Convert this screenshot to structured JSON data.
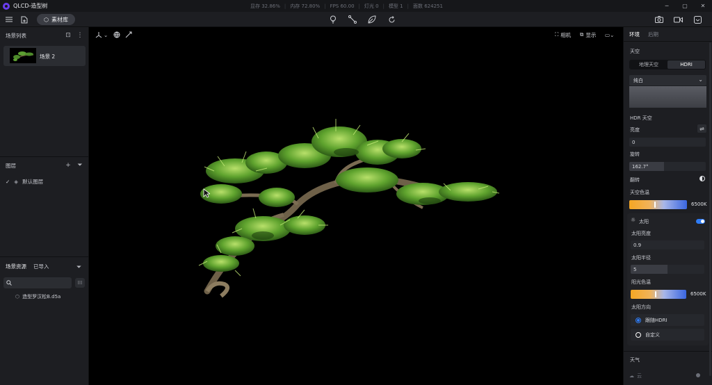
{
  "app": {
    "title": "QLCD-造型树"
  },
  "stats": {
    "vram": "显存 32.86%",
    "ram": "内存 72.80%",
    "fps": "FPS 60.00",
    "lights": "灯光 0",
    "models": "模型 1",
    "faces": "面数 624251"
  },
  "toolbar": {
    "assets_label": "素材库"
  },
  "left": {
    "scene_list_title": "场景列表",
    "scene_name": "场景 2",
    "layers_title": "图层",
    "default_layer": "默认图层",
    "assets_tab": "场景资源",
    "imported_tab": "已导入",
    "search_placeholder": "",
    "file_name": "造型罗汉松B.d5a"
  },
  "viewport": {
    "camera_label": "相机",
    "display_label": "显示"
  },
  "right": {
    "tab_env": "环境",
    "tab_post": "后期",
    "sky_title": "天空",
    "seg_geo": "地理天空",
    "seg_hdri": "HDRI",
    "hdri_preset": "纯白",
    "hdr_sky": "HDR 天空",
    "brightness_label": "亮度",
    "brightness_value": "0",
    "rotation_label": "旋转",
    "rotation_value": "162.7°",
    "rotation_fraction": 0.45,
    "flip_label": "翻转",
    "sky_temp_label": "天空色温",
    "sky_temp_value": "6500K",
    "sun_label": "太阳",
    "sun_bright_label": "太阳亮度",
    "sun_bright_value": "0.9",
    "sun_radius_label": "太阳半径",
    "sun_radius_value": "5",
    "sun_radius_fraction": 0.5,
    "sun_temp_label": "阳光色温",
    "sun_temp_value": "6500K",
    "sun_dir_label": "太阳方向",
    "follow_hdri": "跟随HDRI",
    "custom": "自定义",
    "weather_title": "天气",
    "cloud_label": "云"
  },
  "colors": {
    "accent": "#2f7cf6",
    "brand": "#6a3df0"
  }
}
